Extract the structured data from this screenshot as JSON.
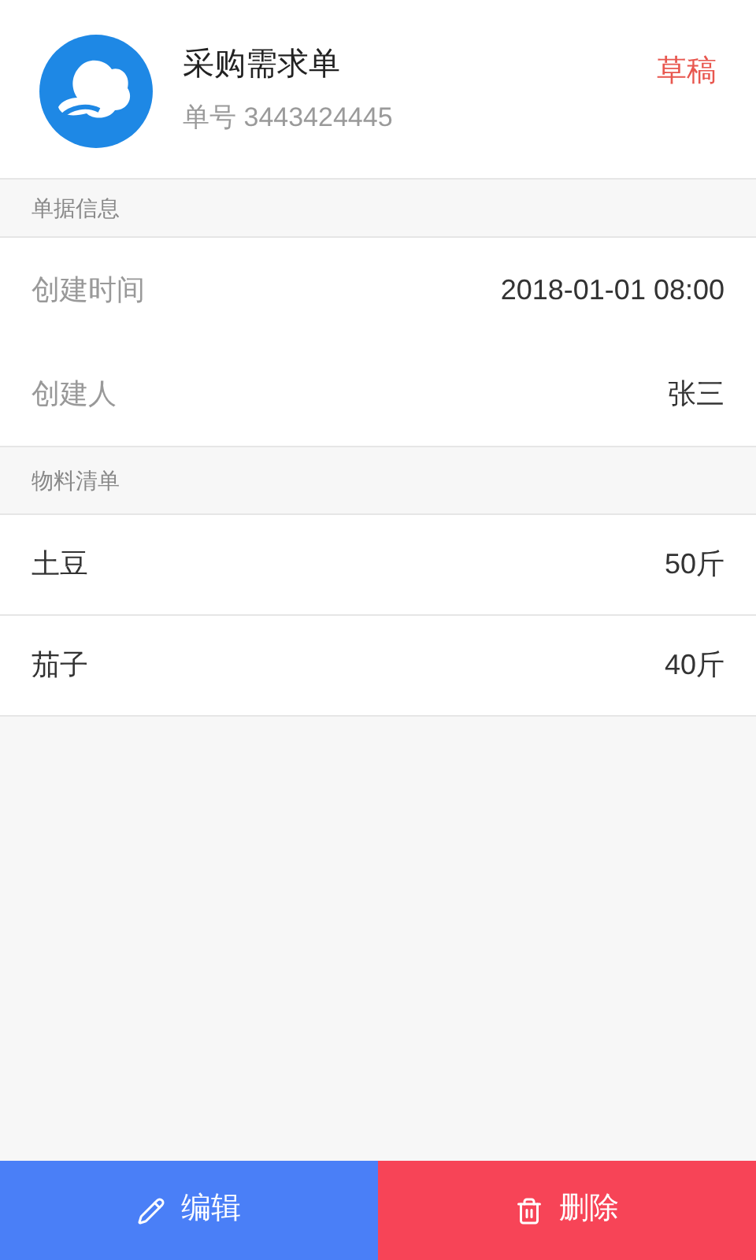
{
  "header": {
    "title": "采购需求单",
    "number_label": "单号",
    "number": "3443424445",
    "status": "草稿"
  },
  "info_section": {
    "title": "单据信息",
    "rows": [
      {
        "label": "创建时间",
        "value": "2018-01-01 08:00"
      },
      {
        "label": "创建人",
        "value": "张三"
      }
    ]
  },
  "materials_section": {
    "title": "物料清单",
    "items": [
      {
        "name": "土豆",
        "quantity": "50斤"
      },
      {
        "name": "茄子",
        "quantity": "40斤"
      }
    ]
  },
  "actions": [
    {
      "kind": "edit",
      "label": "编辑"
    },
    {
      "kind": "delete",
      "label": "删除"
    }
  ]
}
